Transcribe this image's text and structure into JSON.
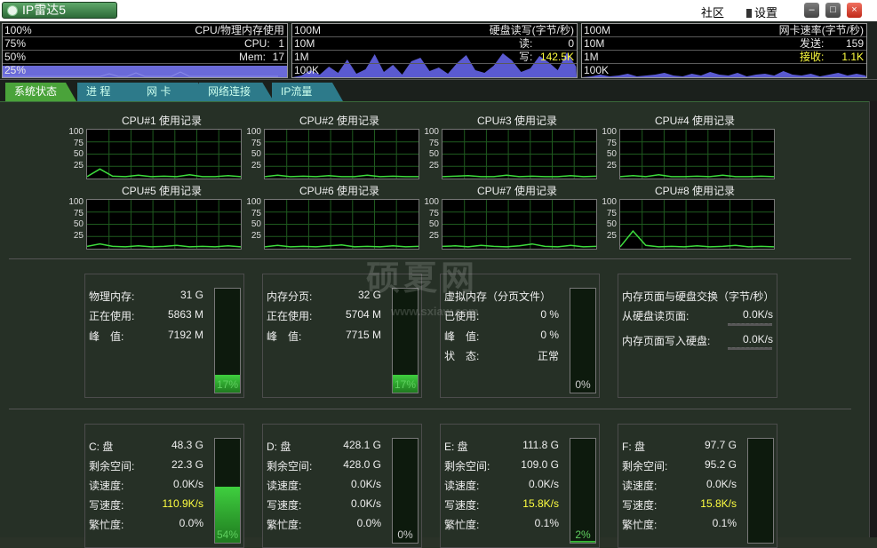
{
  "title_bar": {
    "app_name": "IP雷达5",
    "community_label": "社区",
    "settings_label": "设置",
    "minimize_glyph": "–",
    "maximize_glyph": "□",
    "close_glyph": "×"
  },
  "top_monitors": {
    "cpu_mem": {
      "title": "CPU/物理内存使用",
      "levels": [
        "100%",
        "75%",
        "50%",
        "25%"
      ],
      "cpu_label": "CPU:",
      "cpu_value": "1",
      "mem_label": "Mem:",
      "mem_value": "17"
    },
    "disk": {
      "title": "硬盘读写(字节/秒)",
      "levels": [
        "100M",
        "10M",
        "1M",
        "100K"
      ],
      "read_label": "读:",
      "read_value": "0",
      "write_label": "写:",
      "write_value": "142.5K"
    },
    "net": {
      "title": "网卡速率(字节/秒)",
      "levels": [
        "100M",
        "10M",
        "1M",
        "100K"
      ],
      "send_label": "发送:",
      "send_value": "159",
      "recv_label": "接收:",
      "recv_value": "1.1K"
    }
  },
  "tabs": [
    {
      "label": "系统状态",
      "active": true
    },
    {
      "label": "进 程",
      "active": false
    },
    {
      "label": "网 卡",
      "active": false
    },
    {
      "label": "网络连接",
      "active": false
    },
    {
      "label": "IP流量",
      "active": false
    }
  ],
  "cpu_graphs": {
    "axis": [
      "100",
      "75",
      "50",
      "25"
    ],
    "titles": [
      "CPU#1 使用记录",
      "CPU#2 使用记录",
      "CPU#3 使用记录",
      "CPU#4 使用记录",
      "CPU#5 使用记录",
      "CPU#6 使用记录",
      "CPU#7 使用记录",
      "CPU#8 使用记录"
    ]
  },
  "memory_panels": {
    "physical": {
      "total_label": "物理内存:",
      "total_value": "31 G",
      "used_label": "正在使用:",
      "used_value": "5863 M",
      "peak_label": "峰　值:",
      "peak_value": "7192 M",
      "percent": "17%",
      "fill": 0.17
    },
    "paging": {
      "total_label": "内存分页:",
      "total_value": "32 G",
      "used_label": "正在使用:",
      "used_value": "5704 M",
      "peak_label": "峰　值:",
      "peak_value": "7715 M",
      "percent": "17%",
      "fill": 0.17
    },
    "virtual": {
      "title": "虚拟内存（分页文件）",
      "used_label": "已使用:",
      "used_value": "0 %",
      "peak_label": "峰　值:",
      "peak_value": "0 %",
      "status_label": "状　态:",
      "status_value": "正常",
      "percent": "0%",
      "fill": 0
    },
    "swap": {
      "title": "内存页面与硬盘交换（字节/秒）",
      "in_label": "从硬盘读页面:",
      "in_value": "0.0K/s",
      "out_label": "内存页面写入硬盘:",
      "out_value": "0.0K/s"
    }
  },
  "disks": [
    {
      "name": "C: 盘",
      "total": "48.3 G",
      "free_label": "剩余空间:",
      "free": "22.3 G",
      "read_label": "读速度:",
      "read": "0.0K/s",
      "write_label": "写速度:",
      "write": "110.9K/s",
      "busy_label": "繁忙度:",
      "busy": "0.0%",
      "percent": "54%",
      "fill": 0.54
    },
    {
      "name": "D: 盘",
      "total": "428.1 G",
      "free_label": "剩余空间:",
      "free": "428.0 G",
      "read_label": "读速度:",
      "read": "0.0K/s",
      "write_label": "写速度:",
      "write": "0.0K/s",
      "busy_label": "繁忙度:",
      "busy": "0.0%",
      "percent": "0%",
      "fill": 0
    },
    {
      "name": "E: 盘",
      "total": "111.8 G",
      "free_label": "剩余空间:",
      "free": "109.0 G",
      "read_label": "读速度:",
      "read": "0.0K/s",
      "write_label": "写速度:",
      "write": "15.8K/s",
      "busy_label": "繁忙度:",
      "busy": "0.1%",
      "percent": "2%",
      "fill": 0.02
    },
    {
      "name": "F: 盘",
      "total": "97.7 G",
      "free_label": "剩余空间:",
      "free": "95.2 G",
      "read_label": "读速度:",
      "read": "0.0K/s",
      "write_label": "写速度:",
      "write": "15.8K/s",
      "busy_label": "繁忙度:",
      "busy": "0.1%",
      "percent": "",
      "fill": 0
    }
  ],
  "watermark": {
    "main": "硕夏网",
    "url": "www.sxiaw.com"
  },
  "colors": {
    "accent_green": "#4aa33a",
    "tab_teal": "#2d7a8a",
    "value_yellow": "#ffff40",
    "graph_line": "#3ddc3d",
    "strip_fill": "#6a6ad8"
  }
}
